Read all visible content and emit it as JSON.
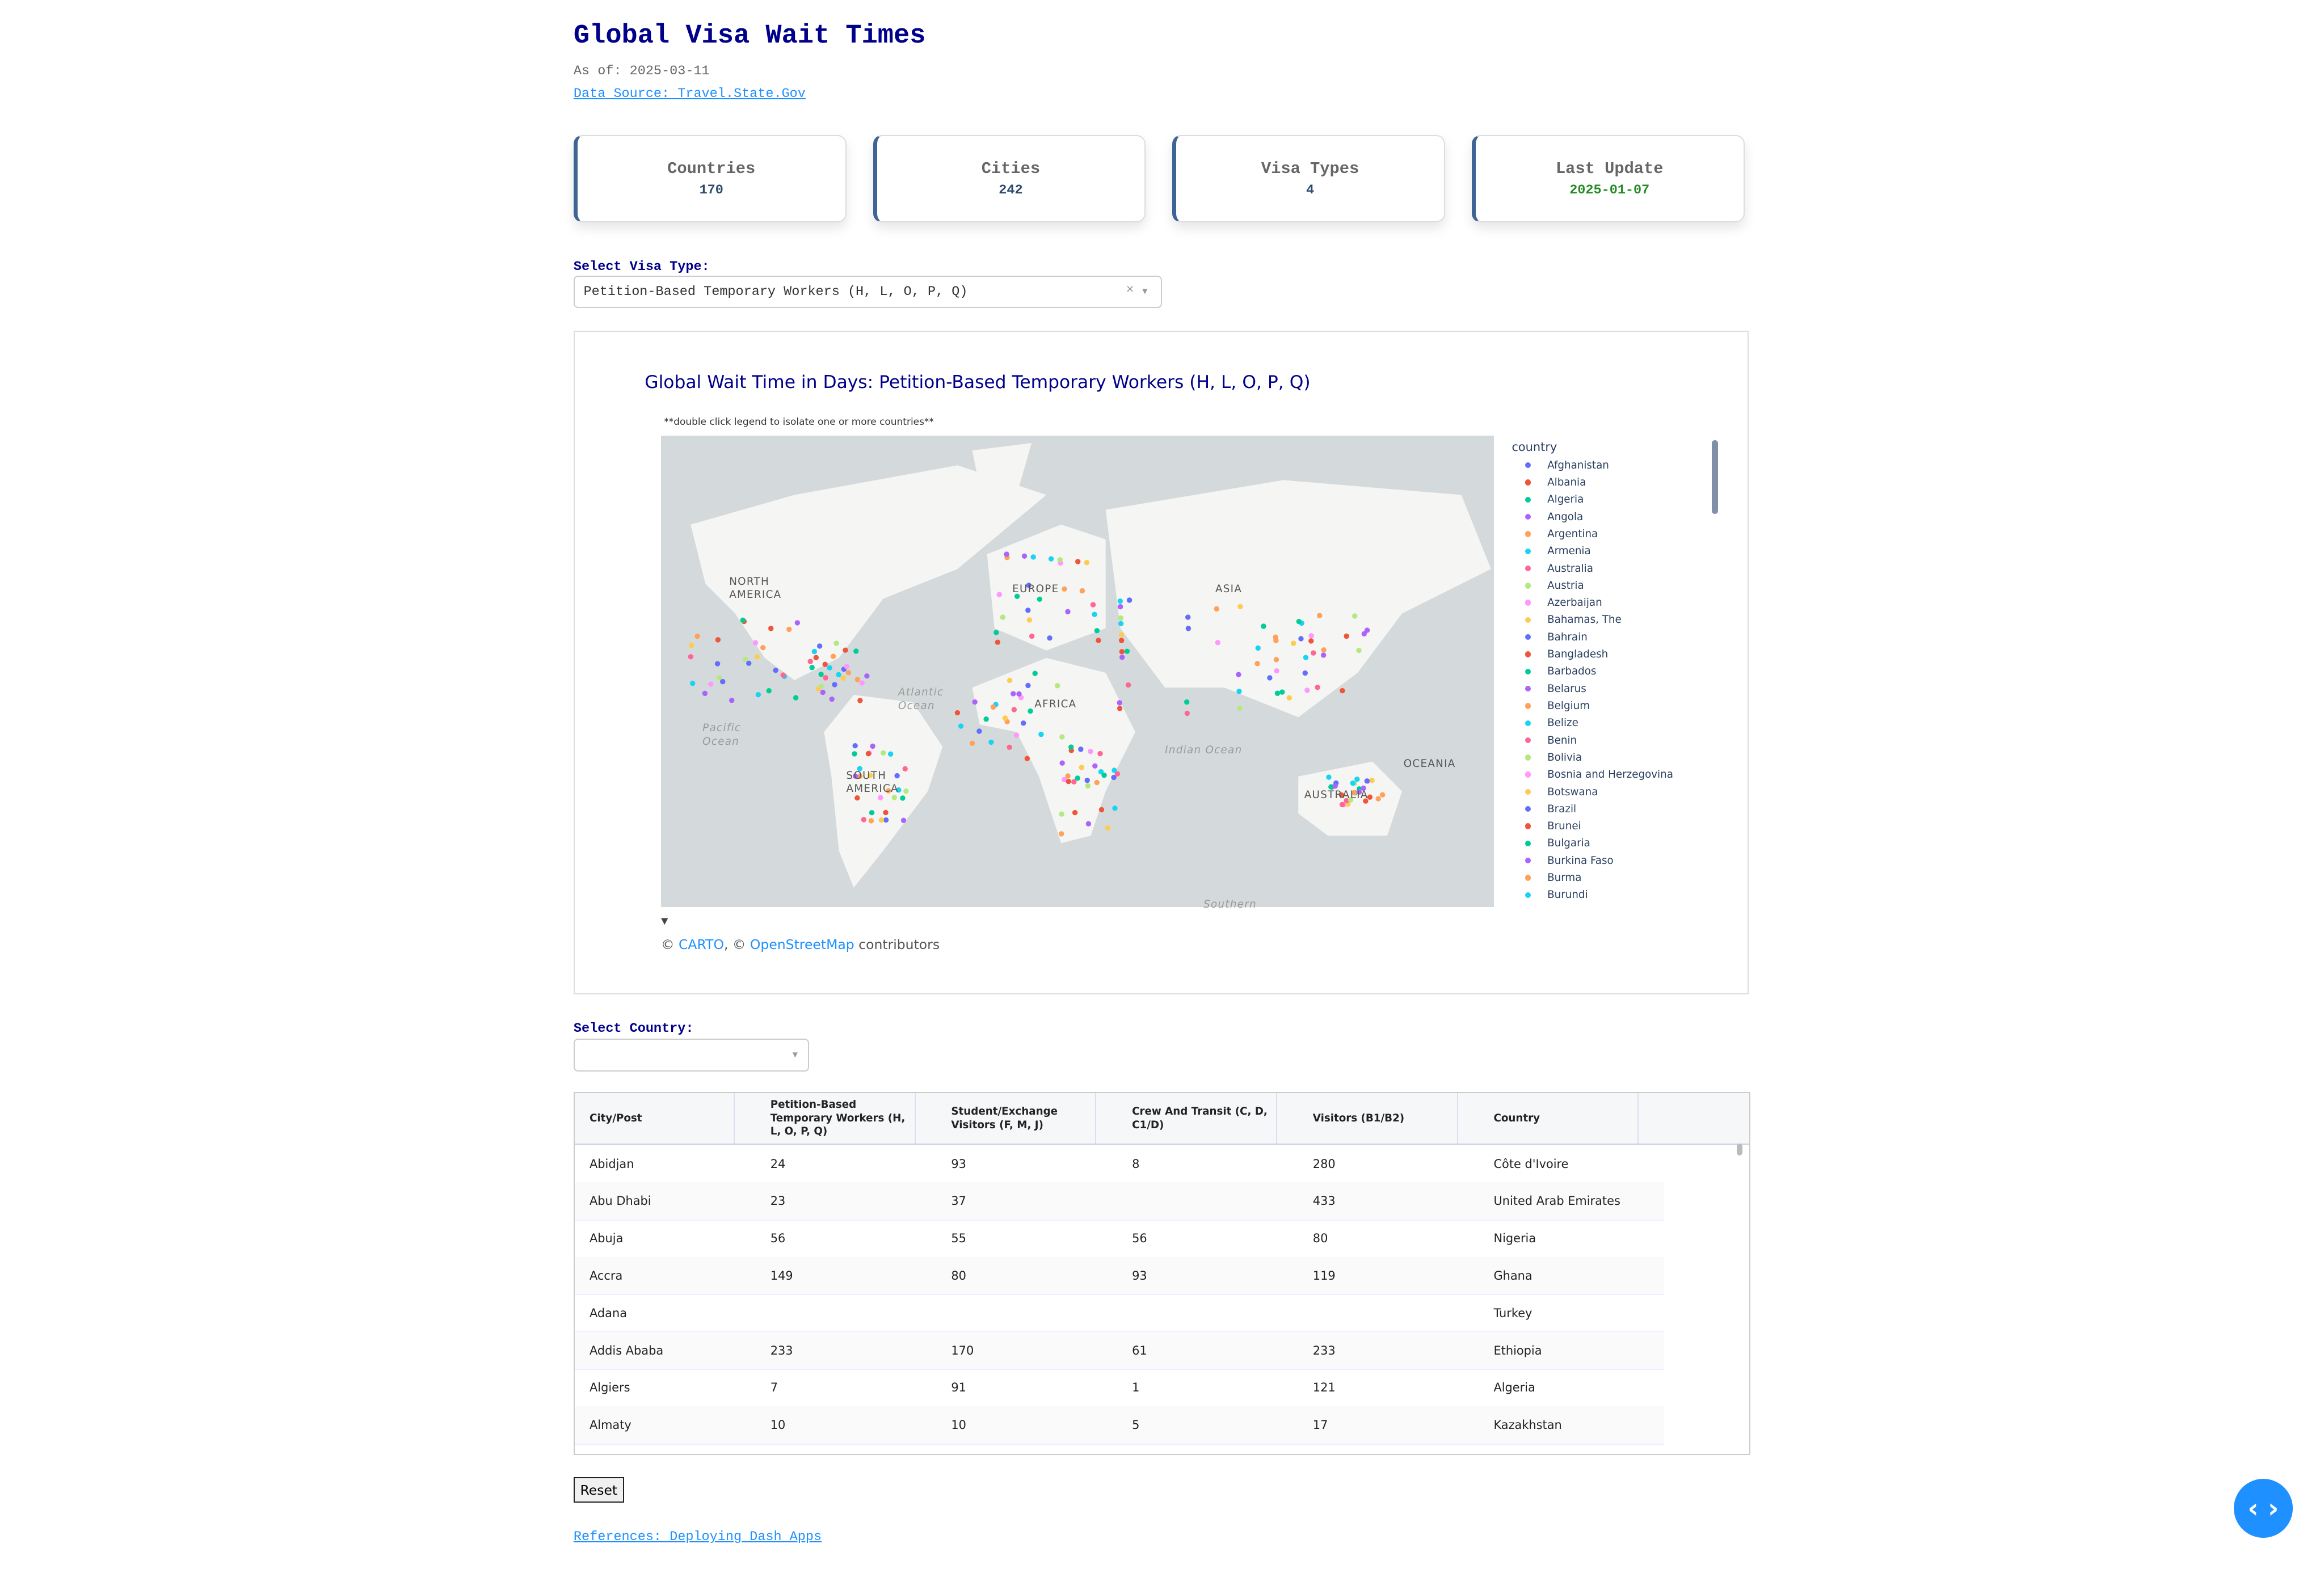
{
  "header": {
    "title": "Global Visa Wait Times",
    "as_of": "As of: 2025-03-11",
    "source_link": "Data Source: Travel.State.Gov"
  },
  "cards": [
    {
      "label": "Countries",
      "value": "170"
    },
    {
      "label": "Cities",
      "value": "242"
    },
    {
      "label": "Visa Types",
      "value": "4"
    },
    {
      "label": "Last Update",
      "value": "2025-01-07",
      "color": "#228b22"
    }
  ],
  "visa_select": {
    "label": "Select Visa Type:",
    "value": "Petition-Based Temporary Workers (H, L, O, P, Q)",
    "clear": "×",
    "arrow": "▾"
  },
  "map": {
    "title": "Global Wait Time in Days: Petition-Based Temporary Workers (H, L, O, P, Q)",
    "hint": "**double click legend to isolate one or more countries**",
    "labels": [
      "NORTH AMERICA",
      "EUROPE",
      "ASIA",
      "AFRICA",
      "SOUTH AMERICA",
      "AUSTRALIA",
      "OCEANIA",
      "Atlantic Ocean",
      "Pacific Ocean",
      "Indian Ocean",
      "Southern"
    ],
    "attribution": {
      "prefix": "© ",
      "carto": "CARTO",
      "mid": ", © ",
      "osm": "OpenStreetMap",
      "suffix": " contributors"
    },
    "collapse": "▼",
    "legend_title": "country",
    "legend": [
      {
        "name": "Afghanistan",
        "color": "#636efa"
      },
      {
        "name": "Albania",
        "color": "#ef553b"
      },
      {
        "name": "Algeria",
        "color": "#00cc96"
      },
      {
        "name": "Angola",
        "color": "#ab63fa"
      },
      {
        "name": "Argentina",
        "color": "#ffa15a"
      },
      {
        "name": "Armenia",
        "color": "#19d3f3"
      },
      {
        "name": "Australia",
        "color": "#ff6692"
      },
      {
        "name": "Austria",
        "color": "#b6e880"
      },
      {
        "name": "Azerbaijan",
        "color": "#ff97ff"
      },
      {
        "name": "Bahamas, The",
        "color": "#fecb52"
      },
      {
        "name": "Bahrain",
        "color": "#636efa"
      },
      {
        "name": "Bangladesh",
        "color": "#ef553b"
      },
      {
        "name": "Barbados",
        "color": "#00cc96"
      },
      {
        "name": "Belarus",
        "color": "#ab63fa"
      },
      {
        "name": "Belgium",
        "color": "#ffa15a"
      },
      {
        "name": "Belize",
        "color": "#19d3f3"
      },
      {
        "name": "Benin",
        "color": "#ff6692"
      },
      {
        "name": "Bolivia",
        "color": "#b6e880"
      },
      {
        "name": "Bosnia and Herzegovina",
        "color": "#ff97ff"
      },
      {
        "name": "Botswana",
        "color": "#fecb52"
      },
      {
        "name": "Brazil",
        "color": "#636efa"
      },
      {
        "name": "Brunei",
        "color": "#ef553b"
      },
      {
        "name": "Bulgaria",
        "color": "#00cc96"
      },
      {
        "name": "Burkina Faso",
        "color": "#ab63fa"
      },
      {
        "name": "Burma",
        "color": "#ffa15a"
      },
      {
        "name": "Burundi",
        "color": "#19d3f3"
      }
    ]
  },
  "country_select": {
    "label": "Select Country:",
    "value": "",
    "arrow": "▾"
  },
  "table": {
    "columns": [
      "City/Post",
      "Petition-Based Temporary Workers (H, L, O, P, Q)",
      "Student/Exchange Visitors (F, M, J)",
      "Crew And Transit (C, D, C1/D)",
      "Visitors (B1/B2)",
      "Country"
    ],
    "rows": [
      [
        "Abidjan",
        "24",
        "93",
        "8",
        "280",
        "Côte d'Ivoire"
      ],
      [
        "Abu Dhabi",
        "23",
        "37",
        "",
        "433",
        "United Arab Emirates"
      ],
      [
        "Abuja",
        "56",
        "55",
        "56",
        "80",
        "Nigeria"
      ],
      [
        "Accra",
        "149",
        "80",
        "93",
        "119",
        "Ghana"
      ],
      [
        "Adana",
        "",
        "",
        "",
        "",
        "Turkey"
      ],
      [
        "Addis Ababa",
        "233",
        "170",
        "61",
        "233",
        "Ethiopia"
      ],
      [
        "Algiers",
        "7",
        "91",
        "1",
        "121",
        "Algeria"
      ],
      [
        "Almaty",
        "10",
        "10",
        "5",
        "17",
        "Kazakhstan"
      ]
    ]
  },
  "reset_label": "Reset",
  "reference_link": "References: Deploying Dash Apps",
  "fab_icon": "‹ ›"
}
